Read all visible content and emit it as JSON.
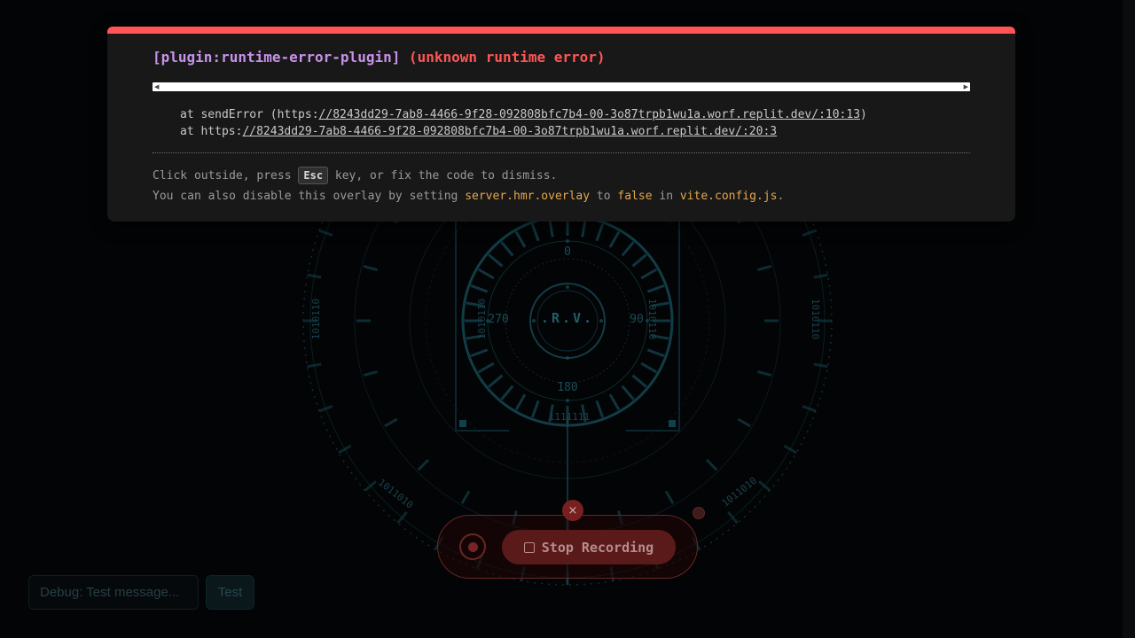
{
  "hud": {
    "core_label": ".R.V.",
    "compass": {
      "north": "0",
      "east": "90",
      "south": "180",
      "west": "270"
    },
    "binary_left": "1010110",
    "binary_right": "1010110",
    "binary_inner_left": "1010110",
    "binary_inner_right": "1010110",
    "binary_bottom": "1111111",
    "binary_lower_left": "1011010",
    "binary_lower_right": "1011010"
  },
  "recorder": {
    "stop_label": "Stop Recording",
    "close_glyph": "×"
  },
  "debug": {
    "input_placeholder": "Debug: Test message...",
    "test_label": "Test"
  },
  "error_overlay": {
    "plugin": "[plugin:runtime-error-plugin]",
    "message": "(unknown runtime error)",
    "stack": [
      {
        "prefix": "at sendError (https:",
        "link": "//8243dd29-7ab8-4466-9f28-092808bfc7b4-00-3o87trpb1wu1a.worf.replit.dev/:10:13",
        "suffix": ")"
      },
      {
        "prefix": "at https:",
        "link": "//8243dd29-7ab8-4466-9f28-092808bfc7b4-00-3o87trpb1wu1a.worf.replit.dev/:20:3",
        "suffix": ""
      }
    ],
    "tip1_before": "Click outside, press",
    "tip1_key": "Esc",
    "tip1_after": "key, or fix the code to dismiss.",
    "tip2_before": "You can also disable this overlay by setting",
    "tip2_setting": "server.hmr.overlay",
    "tip2_to": "to",
    "tip2_value": "false",
    "tip2_in": "in",
    "tip2_file": "vite.config.js",
    "tip2_end": "."
  },
  "colors": {
    "hud_cyan": "#1b5f6e",
    "error_red": "#ff5555",
    "plugin_purple": "#c792ea",
    "code_yellow": "#e6a64a"
  }
}
